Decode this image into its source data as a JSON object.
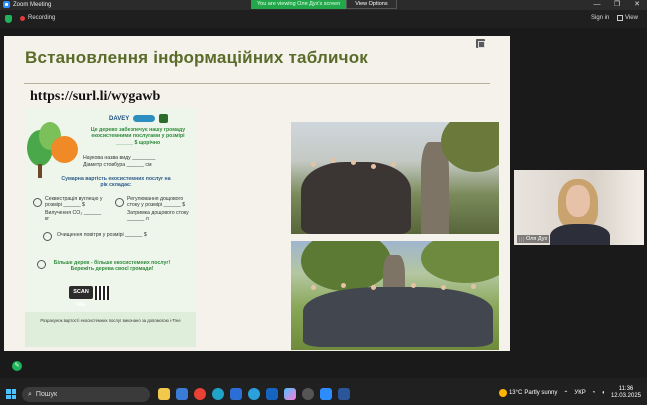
{
  "window": {
    "app_title": "Zoom Meeting",
    "view_banner": "You are viewing Оля Дух's screen",
    "view_options": "View Options",
    "controls": [
      "—",
      "❐",
      "✕"
    ]
  },
  "toolbar": {
    "recording": "Recording",
    "sign_in": "Sign in",
    "view": "View"
  },
  "slide": {
    "title": "Встановлення інформаційних табличок",
    "url": "https://surl.li/wygawb",
    "poster": {
      "logo": "DAVEY",
      "heading": "Це дерево забезпечує нашу громаду екосистемними послугами у розмірі ______ $ щорічно",
      "species": "Наукова назва виду ________",
      "diameter": "Діаметр стовбура ______ см",
      "total_heading": "Сумарна вартість екосистемних послуг на рік складає:",
      "item1": "Секвестрація вуглецю у розмірі ______ $",
      "item2": "Вилучення CO₂ ______ кг",
      "item3": "Регулювання дощового стоку у розмірі ______ $",
      "item4": "Затримка дощового стоку ______ л",
      "air": "Очищення повітря у розмірі ______ $",
      "motto": "Більше дерев - більше екосистемних послуг! Бережіть дерева своєї громади!",
      "scan": "SCAN ME",
      "footer": "Розрахунок вартості екосистемних послуг виконано за допомогою i-Tree"
    }
  },
  "participant": {
    "name": "Оля Дух"
  },
  "taskbar": {
    "search_placeholder": "Пошук",
    "weather_temp": "13°C",
    "weather_desc": "Partly sunny",
    "language": "УКР",
    "time": "11:36",
    "date": "12.03.2025"
  },
  "colors": {
    "slide_title": "#5a6b2a",
    "banner_green": "#22a84a",
    "zoom_blue": "#2d8cff"
  }
}
